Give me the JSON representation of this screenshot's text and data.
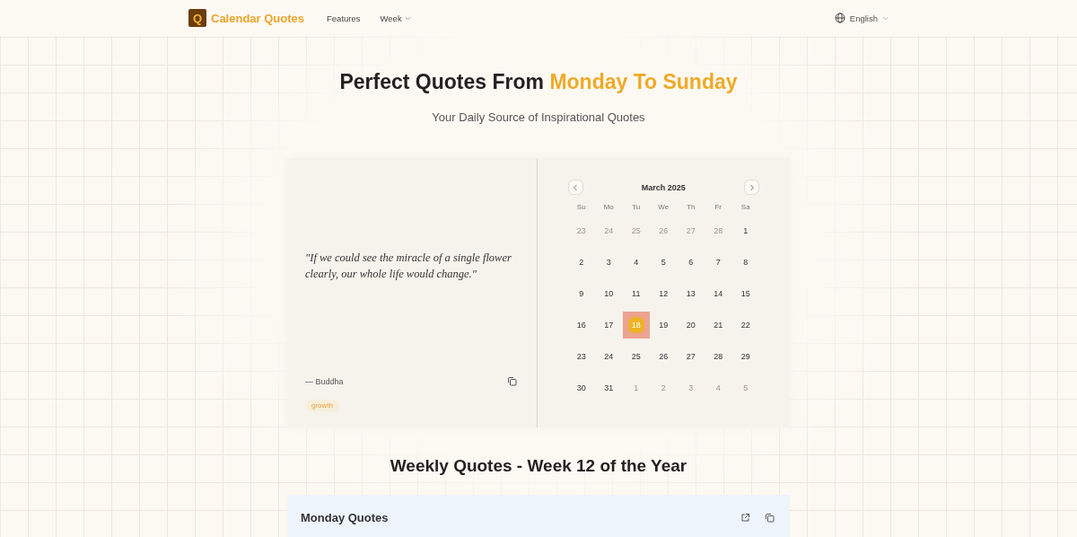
{
  "nav": {
    "logo_letter": "Q",
    "brand": "Calendar Quotes",
    "links": [
      {
        "label": "Features",
        "dropdown": false
      },
      {
        "label": "Week",
        "dropdown": true
      }
    ],
    "language": "English"
  },
  "hero": {
    "title_lead": "Perfect Quotes From",
    "title_highlight": "Monday To Sunday",
    "subtitle": "Your Daily Source of Inspirational Quotes"
  },
  "quote": {
    "text": "\"If we could see the miracle of a single flower clearly, our whole life would change.\"",
    "author": "— Buddha",
    "tag": "growth"
  },
  "calendar": {
    "month": "March 2025",
    "weekdays": [
      "Su",
      "Mo",
      "Tu",
      "We",
      "Th",
      "Fr",
      "Sa"
    ],
    "days": [
      {
        "label": "23",
        "outside": true,
        "selected": false
      },
      {
        "label": "24",
        "outside": true,
        "selected": false
      },
      {
        "label": "25",
        "outside": true,
        "selected": false
      },
      {
        "label": "26",
        "outside": true,
        "selected": false
      },
      {
        "label": "27",
        "outside": true,
        "selected": false
      },
      {
        "label": "28",
        "outside": true,
        "selected": false
      },
      {
        "label": "1",
        "outside": false,
        "selected": false
      },
      {
        "label": "2",
        "outside": false,
        "selected": false
      },
      {
        "label": "3",
        "outside": false,
        "selected": false
      },
      {
        "label": "4",
        "outside": false,
        "selected": false
      },
      {
        "label": "5",
        "outside": false,
        "selected": false
      },
      {
        "label": "6",
        "outside": false,
        "selected": false
      },
      {
        "label": "7",
        "outside": false,
        "selected": false
      },
      {
        "label": "8",
        "outside": false,
        "selected": false
      },
      {
        "label": "9",
        "outside": false,
        "selected": false
      },
      {
        "label": "10",
        "outside": false,
        "selected": false
      },
      {
        "label": "11",
        "outside": false,
        "selected": false
      },
      {
        "label": "12",
        "outside": false,
        "selected": false
      },
      {
        "label": "13",
        "outside": false,
        "selected": false
      },
      {
        "label": "14",
        "outside": false,
        "selected": false
      },
      {
        "label": "15",
        "outside": false,
        "selected": false
      },
      {
        "label": "16",
        "outside": false,
        "selected": false
      },
      {
        "label": "17",
        "outside": false,
        "selected": false
      },
      {
        "label": "18",
        "outside": false,
        "selected": true
      },
      {
        "label": "19",
        "outside": false,
        "selected": false
      },
      {
        "label": "20",
        "outside": false,
        "selected": false
      },
      {
        "label": "21",
        "outside": false,
        "selected": false
      },
      {
        "label": "22",
        "outside": false,
        "selected": false
      },
      {
        "label": "23",
        "outside": false,
        "selected": false
      },
      {
        "label": "24",
        "outside": false,
        "selected": false
      },
      {
        "label": "25",
        "outside": false,
        "selected": false
      },
      {
        "label": "26",
        "outside": false,
        "selected": false
      },
      {
        "label": "27",
        "outside": false,
        "selected": false
      },
      {
        "label": "28",
        "outside": false,
        "selected": false
      },
      {
        "label": "29",
        "outside": false,
        "selected": false
      },
      {
        "label": "30",
        "outside": false,
        "selected": false
      },
      {
        "label": "31",
        "outside": false,
        "selected": false
      },
      {
        "label": "1",
        "outside": true,
        "selected": false
      },
      {
        "label": "2",
        "outside": true,
        "selected": false
      },
      {
        "label": "3",
        "outside": true,
        "selected": false
      },
      {
        "label": "4",
        "outside": true,
        "selected": false
      },
      {
        "label": "5",
        "outside": true,
        "selected": false
      }
    ]
  },
  "weekly": {
    "title": "Weekly Quotes - Week 12 of the Year",
    "cards": [
      {
        "title": "Monday Quotes"
      }
    ]
  }
}
